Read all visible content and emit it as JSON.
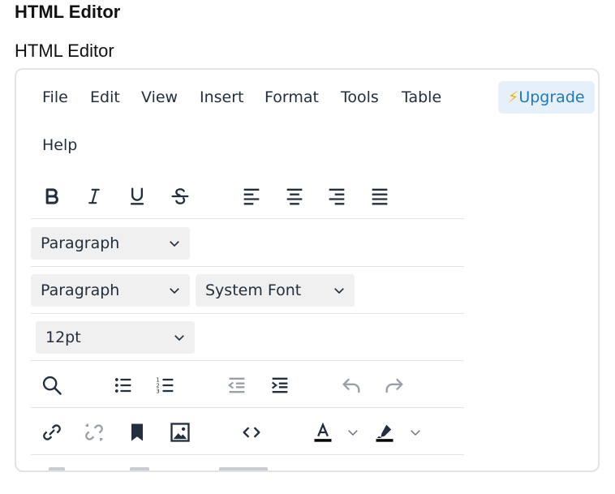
{
  "page": {
    "heading": "HTML Editor",
    "field_label": "HTML Editor"
  },
  "menubar": {
    "items": [
      "File",
      "Edit",
      "View",
      "Insert",
      "Format",
      "Tools",
      "Table",
      "Help"
    ],
    "upgrade_label": "Upgrade"
  },
  "toolbar": {
    "block_format_1": "Paragraph",
    "block_format_2": "Paragraph",
    "font_family": "System Font",
    "font_size": "12pt"
  },
  "colors": {
    "menu_text": "#222f3e",
    "upgrade_bg": "#e6f0fa",
    "upgrade_text": "#207ab7",
    "bolt": "#f3b300",
    "border": "#e3e3e3",
    "select_bg": "#f0f0f0"
  },
  "icons": [
    "bold-icon",
    "italic-icon",
    "underline-icon",
    "strikethrough-icon",
    "align-left-icon",
    "align-center-icon",
    "align-right-icon",
    "align-justify-icon",
    "search-icon",
    "bullet-list-icon",
    "numbered-list-icon",
    "outdent-icon",
    "indent-icon",
    "undo-icon",
    "redo-icon",
    "link-icon",
    "unlink-icon",
    "bookmark-icon",
    "image-icon",
    "code-icon",
    "text-color-icon",
    "highlight-color-icon",
    "chevron-down-icon"
  ]
}
